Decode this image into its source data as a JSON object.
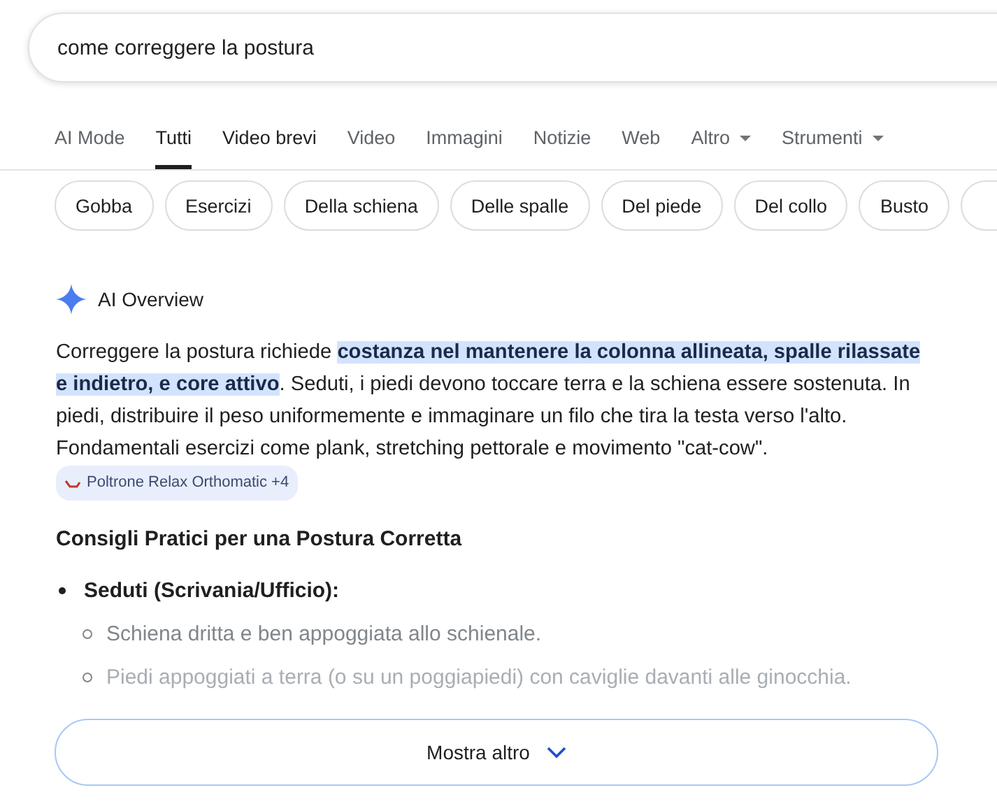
{
  "search": {
    "value": "come correggere la postura"
  },
  "tabs": [
    {
      "label": "AI Mode",
      "selected": false,
      "emphasized": false,
      "dropdown": false
    },
    {
      "label": "Tutti",
      "selected": true,
      "emphasized": false,
      "dropdown": false
    },
    {
      "label": "Video brevi",
      "selected": false,
      "emphasized": true,
      "dropdown": false
    },
    {
      "label": "Video",
      "selected": false,
      "emphasized": false,
      "dropdown": false
    },
    {
      "label": "Immagini",
      "selected": false,
      "emphasized": false,
      "dropdown": false
    },
    {
      "label": "Notizie",
      "selected": false,
      "emphasized": false,
      "dropdown": false
    },
    {
      "label": "Web",
      "selected": false,
      "emphasized": false,
      "dropdown": false
    },
    {
      "label": "Altro",
      "selected": false,
      "emphasized": false,
      "dropdown": true
    },
    {
      "label": "Strumenti",
      "selected": false,
      "emphasized": false,
      "dropdown": true
    }
  ],
  "chips": [
    "Gobba",
    "Esercizi",
    "Della schiena",
    "Delle spalle",
    "Del piede",
    "Del collo",
    "Busto"
  ],
  "ai_overview": {
    "title": "AI Overview",
    "paragraph": {
      "intro": "Correggere la postura richiede ",
      "highlight": "costanza nel mantenere la colonna allineata, spalle rilassate e indietro, e core attivo",
      "rest": ". Seduti, i piedi devono toccare terra e la schiena essere sostenuta. In piedi, distribuire il peso uniformemente e immaginare un filo che tira la testa verso l'alto. Fondamentali esercizi come plank, stretching pettorale e movimento \"cat-cow\". ",
      "source_chip": "Poltrone Relax Orthomatic +4"
    },
    "heading": "Consigli Pratici per una Postura Corretta",
    "sections": [
      {
        "title": "Seduti (Scrivania/Ufficio):",
        "items": [
          {
            "text": "Schiena dritta e ben appoggiata allo schienale.",
            "faded": false
          },
          {
            "text": "Piedi appoggiati a terra (o su un poggiapiedi) con caviglie davanti alle ginocchia.",
            "faded": true
          }
        ]
      }
    ],
    "show_more": "Mostra altro"
  }
}
